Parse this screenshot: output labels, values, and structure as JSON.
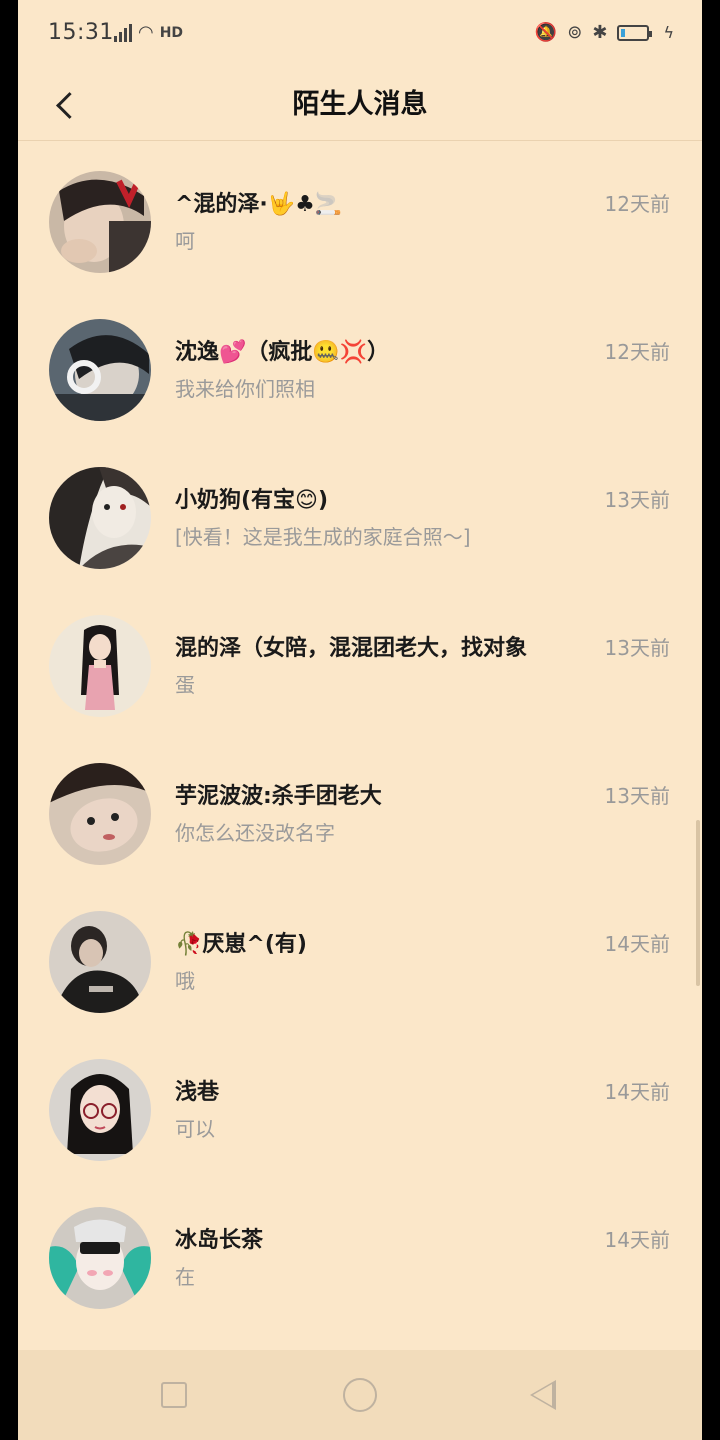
{
  "status": {
    "time": "15:31",
    "network": "4G",
    "hd": "HD",
    "battery_level": 0.18
  },
  "header": {
    "title": "陌生人消息"
  },
  "conversations": [
    {
      "name": "^混的泽·🤟♣🚬",
      "preview": "呵",
      "time": "12天前"
    },
    {
      "name": "沈逸💕（疯批🤐💢）",
      "preview": "我来给你们照相",
      "time": "12天前"
    },
    {
      "name": "小奶狗(有宝😊)",
      "preview": "[快看！这是我生成的家庭合照～]",
      "time": "13天前"
    },
    {
      "name": "混的泽（女陪，混混团老大，找对象",
      "preview": "蛋",
      "time": "13天前"
    },
    {
      "name": "芋泥波波:杀手团老大",
      "preview": "你怎么还没改名字",
      "time": "13天前"
    },
    {
      "name": "🥀厌崽^(有)",
      "preview": "哦",
      "time": "14天前"
    },
    {
      "name": "浅巷",
      "preview": "可以",
      "time": "14天前"
    },
    {
      "name": "冰岛长茶",
      "preview": "在",
      "time": "14天前"
    }
  ],
  "colors": {
    "background": "#fbe7c9",
    "title": "#111111",
    "preview": "#9a9a9a",
    "navbar": "#f2dcbb"
  }
}
